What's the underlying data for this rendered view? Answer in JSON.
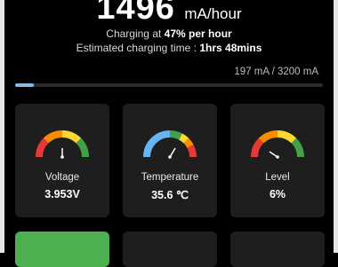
{
  "header": {
    "rate_value": "1496",
    "rate_unit": "mA/hour",
    "charging_prefix": "Charging at",
    "charging_value": "47% per hour",
    "estimate_prefix": "Estimated charging time :",
    "estimate_value": "1hrs 48mins"
  },
  "capacity": {
    "text": "197 mA / 3200 mA",
    "progress_fraction": 0.06
  },
  "cards": [
    {
      "label": "Voltage",
      "value": "3.953V",
      "gauge": "green-icon"
    },
    {
      "label": "Temperature",
      "value": "35.6 ℃",
      "gauge": "blue-icon"
    },
    {
      "label": "Level",
      "value": "6%",
      "gauge": "red-icon"
    }
  ],
  "colors": {
    "accent_green": "#4caf50",
    "progress_fill": "#8ab9e8",
    "gauge_red": "#e53935",
    "gauge_orange": "#fb8c00",
    "gauge_yellow": "#fdd835",
    "gauge_green": "#43a047",
    "gauge_blue": "#64b5f6"
  }
}
